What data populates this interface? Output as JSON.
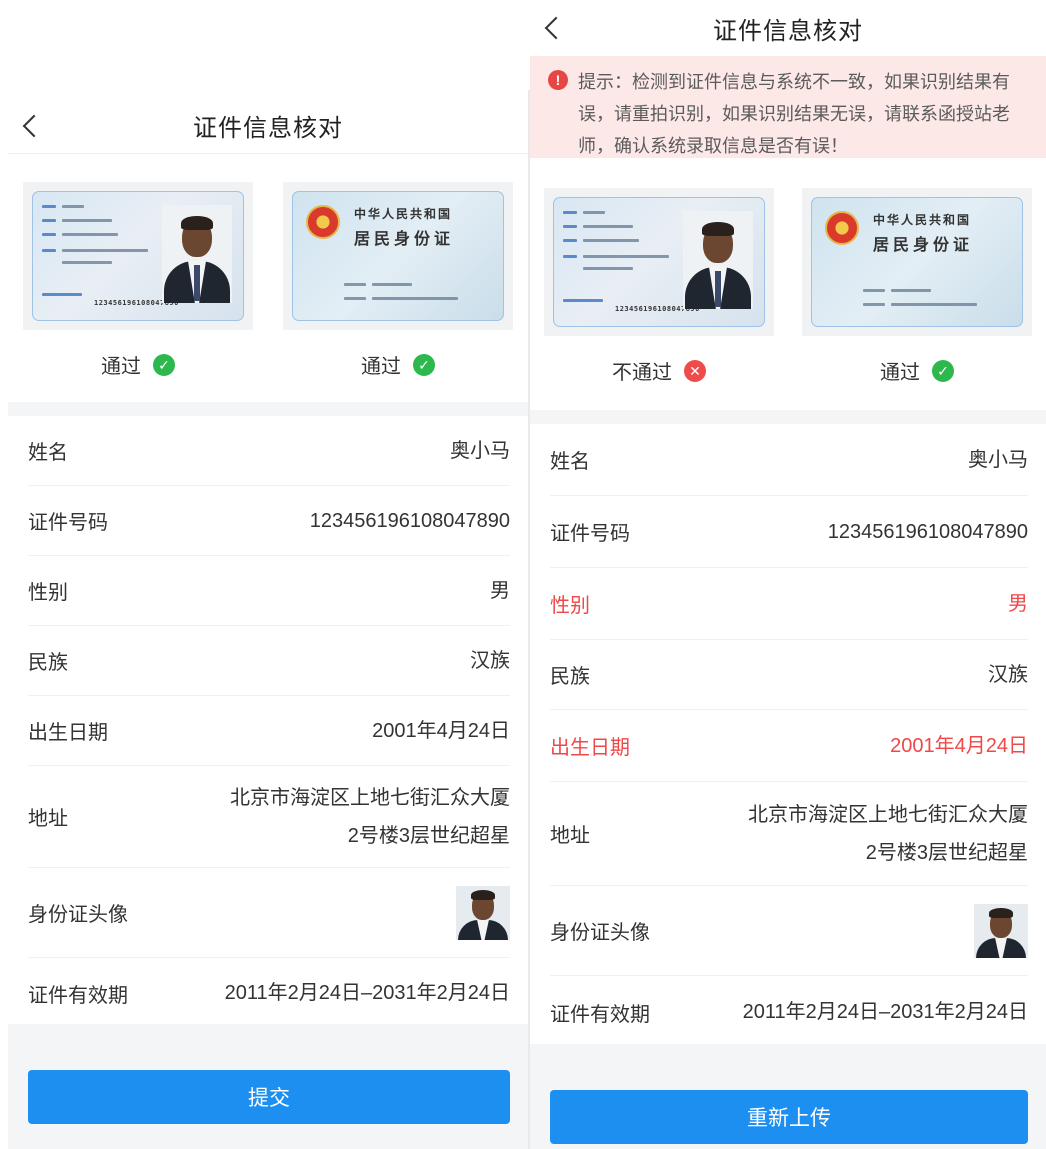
{
  "left": {
    "title": "证件信息核对",
    "cards": [
      {
        "status": "通过",
        "result": "pass"
      },
      {
        "status": "通过",
        "result": "pass"
      }
    ],
    "rows": [
      {
        "label": "姓名",
        "value": "奥小马"
      },
      {
        "label": "证件号码",
        "value": "123456196108047890"
      },
      {
        "label": "性别",
        "value": "男"
      },
      {
        "label": "民族",
        "value": "汉族"
      },
      {
        "label": "出生日期",
        "value": "2001年4月24日"
      },
      {
        "label": "地址",
        "value1": "北京市海淀区上地七街汇众大厦",
        "value2": "2号楼3层世纪超星"
      },
      {
        "label": "身份证头像"
      },
      {
        "label": "证件有效期",
        "value": "2011年2月24日–2031年2月24日"
      }
    ],
    "button": "提交"
  },
  "right": {
    "title": "证件信息核对",
    "alert": "提示：检测到证件信息与系统不一致，如果识别结果有误，请重拍识别，如果识别结果无误，请联系函授站老师，确认系统录取信息是否有误！",
    "cards": [
      {
        "status": "不通过",
        "result": "fail"
      },
      {
        "status": "通过",
        "result": "pass"
      }
    ],
    "rows": [
      {
        "label": "姓名",
        "value": "奥小马"
      },
      {
        "label": "证件号码",
        "value": "123456196108047890"
      },
      {
        "label": "性别",
        "value": "男",
        "error": true
      },
      {
        "label": "民族",
        "value": "汉族"
      },
      {
        "label": "出生日期",
        "value": "2001年4月24日",
        "error": true
      },
      {
        "label": "地址",
        "value1": "北京市海淀区上地七街汇众大厦",
        "value2": "2号楼3层世纪超星"
      },
      {
        "label": "身份证头像"
      },
      {
        "label": "证件有效期",
        "value": "2011年2月24日–2031年2月24日"
      }
    ],
    "button": "重新上传"
  },
  "idcard": {
    "front_number": "123456196108047890",
    "back_title1": "中华人民共和国",
    "back_title2": "居民身份证"
  },
  "colors": {
    "accent": "#1d8ff0",
    "pass": "#2db84d",
    "fail": "#ee4b4b",
    "error_text": "#f04848",
    "alert_bg": "#fde8e8"
  }
}
